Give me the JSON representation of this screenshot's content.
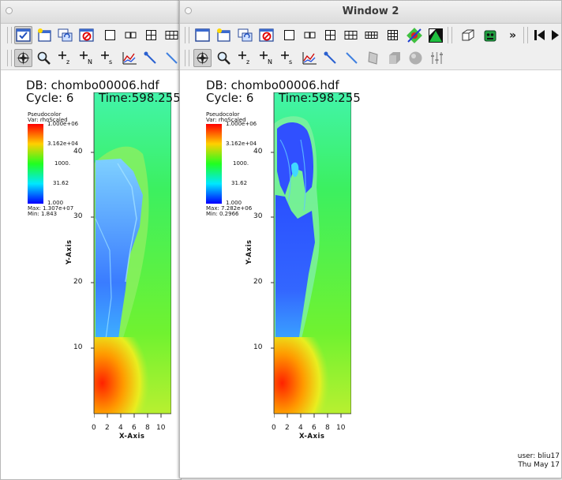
{
  "windows": [
    {
      "id": "win1",
      "title": "",
      "plot": {
        "db": "DB: chombo00006.hdf",
        "cycle": "Cycle: 6",
        "time": "Time:598.255",
        "legend": {
          "plot_type": "Pseudocolor",
          "var": "Var: rhoScaled",
          "ticks": [
            "1.000e+06",
            "3.162e+04",
            "1000.",
            "31.62",
            "1.000"
          ],
          "max": "Max: 1.307e+07",
          "min": "Min: 1.843"
        }
      }
    },
    {
      "id": "win2",
      "title": "Window 2",
      "plot": {
        "db": "DB: chombo00006.hdf",
        "cycle": "Cycle: 6",
        "time": "Time:598.255",
        "legend": {
          "plot_type": "Pseudocolor",
          "var": "Var: rhoScaled",
          "ticks": [
            "1.000e+06",
            "3.162e+04",
            "1000.",
            "31.62",
            "1.000"
          ],
          "max": "Max: 7.282e+06",
          "min": "Min: 0.2966"
        }
      },
      "footer": {
        "user": "user: bliu17",
        "date": "Thu May 17"
      }
    }
  ],
  "axes": {
    "x_title": "X-Axis",
    "y_title": "Y-Axis",
    "x_ticks": [
      "0",
      "2",
      "4",
      "6",
      "8",
      "10"
    ],
    "y_ticks": [
      "10",
      "20",
      "30",
      "40"
    ]
  },
  "toolbar": {
    "overflow_label": "»"
  },
  "colors": {
    "field_background": "#3cf060",
    "jet_core": "#ff3000"
  }
}
